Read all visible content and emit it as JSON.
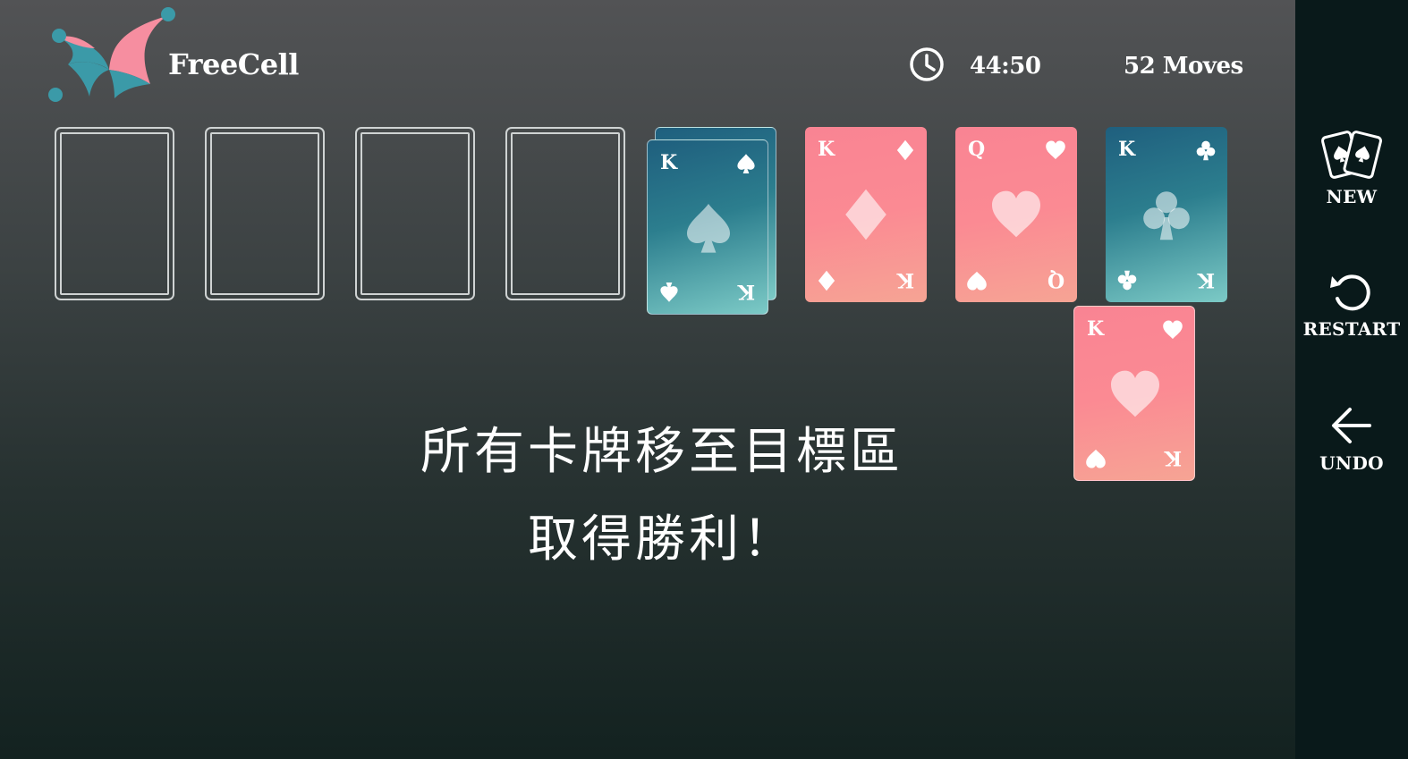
{
  "header": {
    "app_title": "FreeCell",
    "timer": "44:50",
    "moves": "52 Moves",
    "icons": {
      "logo": "jester-hat-logo",
      "timer": "clock-icon"
    }
  },
  "free_cells": [
    {
      "empty": true
    },
    {
      "empty": true
    },
    {
      "empty": true
    },
    {
      "empty": true
    }
  ],
  "foundations": [
    {
      "rank": "K",
      "suit": "spade",
      "color": "teal"
    },
    {
      "rank": "K",
      "suit": "diamond",
      "color": "red"
    },
    {
      "rank": "Q",
      "suit": "heart",
      "color": "red"
    },
    {
      "rank": "K",
      "suit": "club",
      "color": "teal"
    }
  ],
  "dragged_card": {
    "rank": "K",
    "suit": "heart",
    "color": "red"
  },
  "message": {
    "line1": "所有卡牌移至目標區",
    "line2": "取得勝利！"
  },
  "sidebar": {
    "new_label": "NEW",
    "restart_label": "RESTART",
    "undo_label": "UNDO",
    "icons": {
      "new": "cards-icon",
      "restart": "restart-icon",
      "undo": "arrow-left-icon"
    }
  },
  "colors": {
    "card_red": "#fb8a93",
    "card_teal": "#2c7e8e",
    "sidebar_bg": "#09191a",
    "logo_pink": "#f68ea0",
    "logo_teal": "#3b9aa8"
  }
}
